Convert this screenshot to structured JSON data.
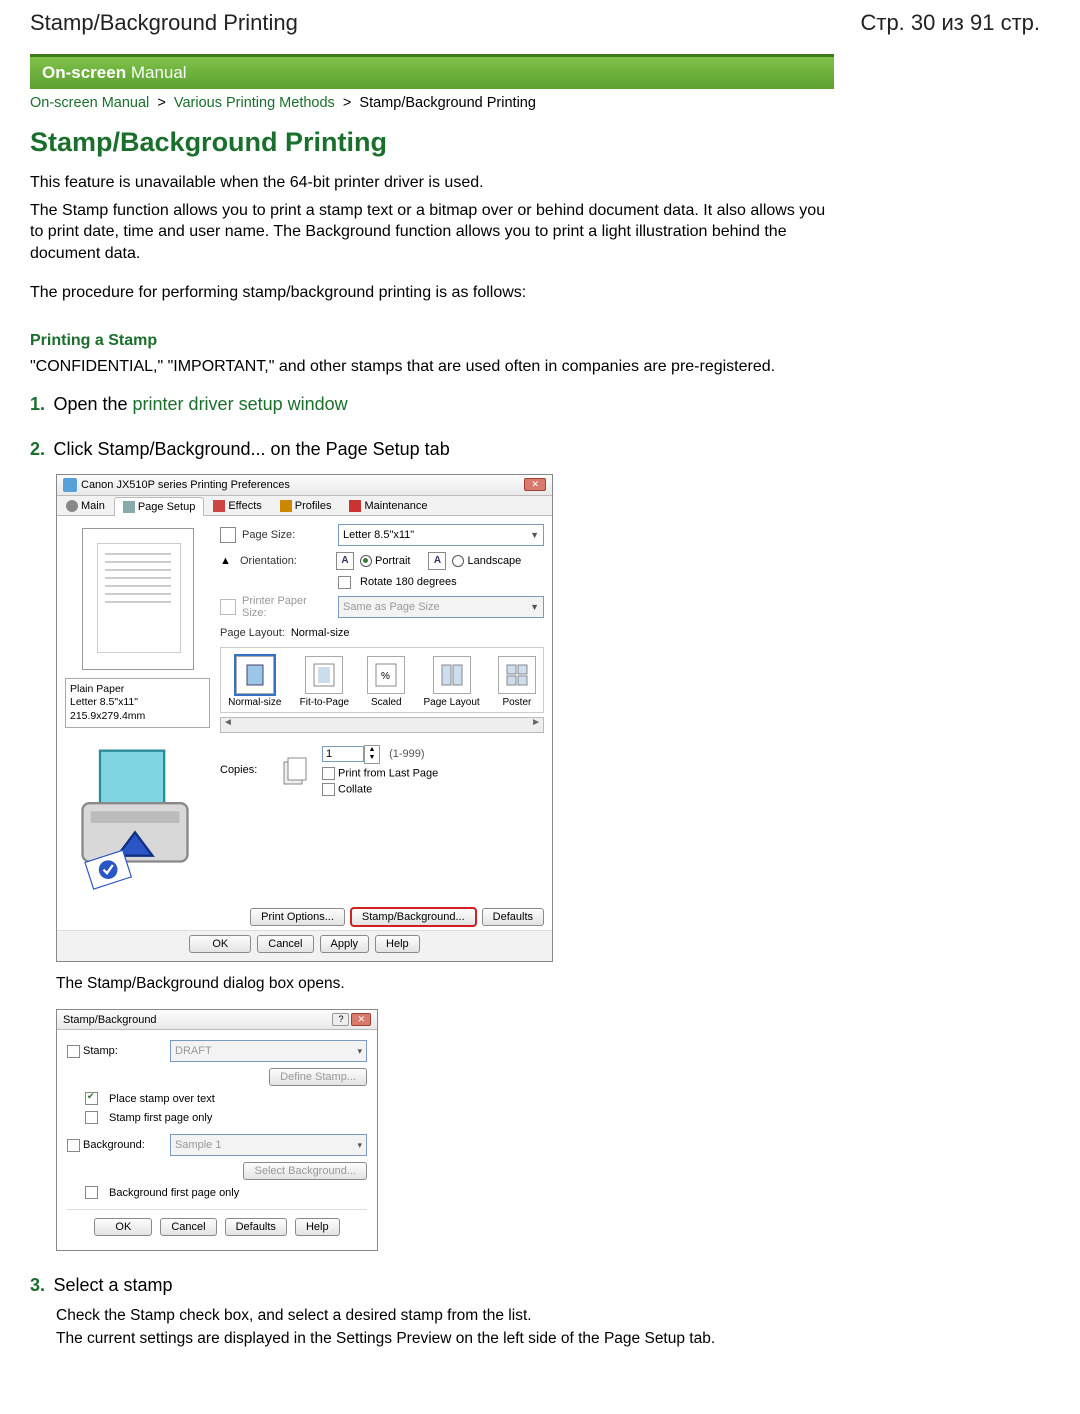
{
  "header": {
    "left": "Stamp/Background Printing",
    "right": "Стр. 30 из 91 стр."
  },
  "green_bar": "On-screen Manual",
  "breadcrumb": {
    "a1": "On-screen Manual",
    "a2": "Various Printing Methods",
    "current": "Stamp/Background Printing"
  },
  "title": "Stamp/Background Printing",
  "intro1": "This feature is unavailable when the 64-bit printer driver is used.",
  "intro2": "The Stamp function allows you to print a stamp text or a bitmap over or behind document data. It also allows you to print date, time and user name. The Background function allows you to print a light illustration behind the document data.",
  "intro3": "The procedure for performing stamp/background printing is as follows:",
  "section1": "Printing a Stamp",
  "section1_text": "\"CONFIDENTIAL,\" \"IMPORTANT,\" and other stamps that are used often in companies are pre-registered.",
  "steps": {
    "s1": {
      "num": "1.",
      "text_pre": "Open the ",
      "link": "printer driver setup window"
    },
    "s2": {
      "num": "2.",
      "text": "Click Stamp/Background... on the Page Setup tab"
    },
    "s2_after": "The Stamp/Background dialog box opens.",
    "s3": {
      "num": "3.",
      "text": "Select a stamp"
    },
    "s3_sub1": "Check the Stamp check box, and select a desired stamp from the list.",
    "s3_sub2": "The current settings are displayed in the Settings Preview on the left side of the Page Setup tab."
  },
  "dialog1": {
    "title": "Canon JX510P series Printing Preferences",
    "close": "✕",
    "tabs": {
      "main": "Main",
      "page": "Page Setup",
      "effects": "Effects",
      "profiles": "Profiles",
      "maint": "Maintenance"
    },
    "page_size_lbl": "Page Size:",
    "page_size_val": "Letter 8.5\"x11\"",
    "orient_lbl": "Orientation:",
    "orient_portrait": "Portrait",
    "orient_landscape": "Landscape",
    "rotate": "Rotate 180 degrees",
    "printer_paper_lbl": "Printer Paper Size:",
    "printer_paper_val": "Same as Page Size",
    "page_layout_lbl": "Page Layout:",
    "page_layout_val": "Normal-size",
    "layouts": {
      "normal": "Normal-size",
      "fit": "Fit-to-Page",
      "scaled": "Scaled",
      "page": "Page Layout",
      "poster": "Poster"
    },
    "copies_lbl": "Copies:",
    "copies_val": "1",
    "copies_range": "(1-999)",
    "print_last": "Print from Last Page",
    "collate": "Collate",
    "paper_info_line1": "Plain Paper",
    "paper_info_line2": "Letter 8.5\"x11\" 215.9x279.4mm",
    "btn_print_options": "Print Options...",
    "btn_stamp_bg": "Stamp/Background...",
    "btn_defaults": "Defaults",
    "btn_ok": "OK",
    "btn_cancel": "Cancel",
    "btn_apply": "Apply",
    "btn_help": "Help"
  },
  "dialog2": {
    "title": "Stamp/Background",
    "stamp_lbl": "Stamp:",
    "stamp_val": "DRAFT",
    "define_stamp": "Define Stamp...",
    "place_over": "Place stamp over text",
    "first_page": "Stamp first page only",
    "bg_lbl": "Background:",
    "bg_val": "Sample 1",
    "select_bg": "Select Background...",
    "bg_first": "Background first page only",
    "btn_ok": "OK",
    "btn_cancel": "Cancel",
    "btn_defaults": "Defaults",
    "btn_help": "Help"
  }
}
